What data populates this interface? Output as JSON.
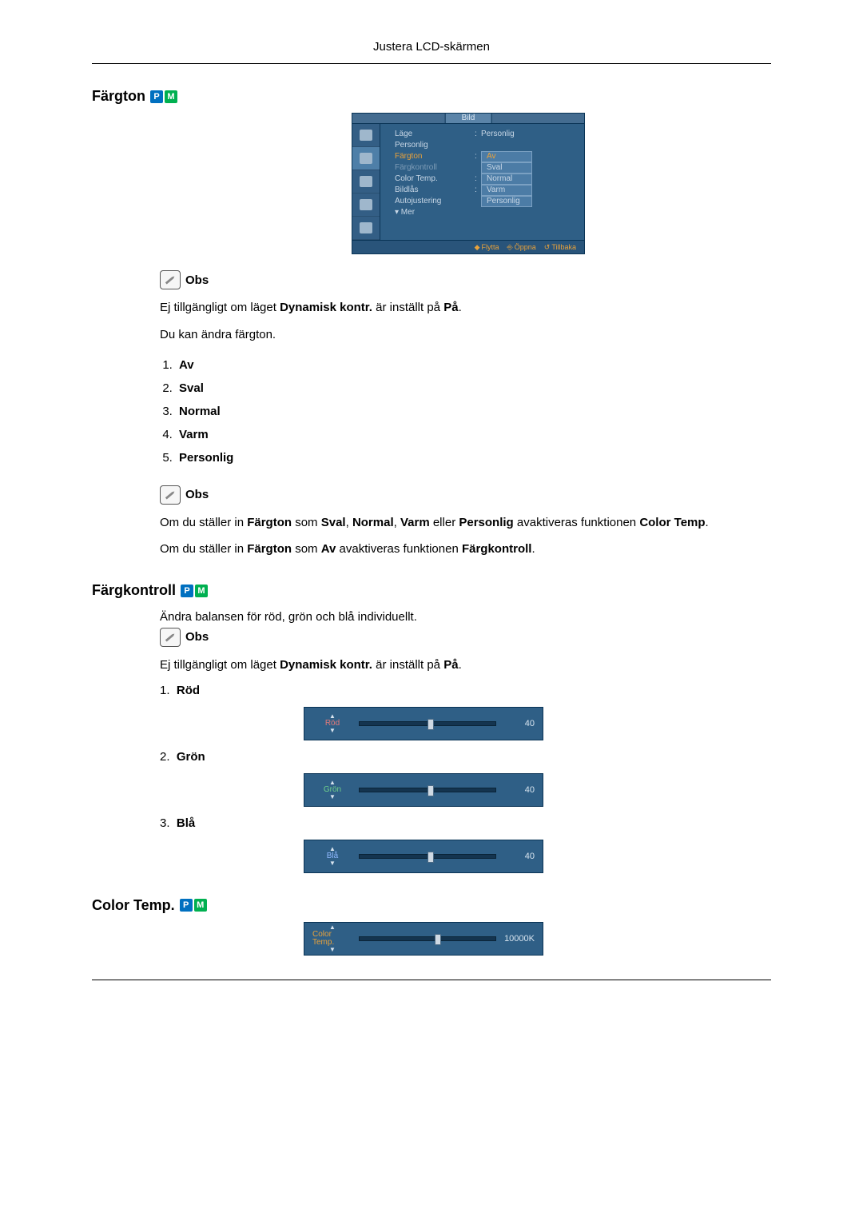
{
  "header": "Justera LCD-skärmen",
  "badges": {
    "p": "P",
    "m": "M"
  },
  "sections": {
    "fargton": {
      "title": "Färgton",
      "osd": {
        "tab": "Bild",
        "rows": {
          "lage": {
            "label": "Läge",
            "value": "Personlig"
          },
          "personlig": {
            "label": "Personlig"
          },
          "fargton": {
            "label": "Färgton",
            "value": "Av"
          },
          "fargkontroll": {
            "label": "Färgkontroll",
            "value": "Sval"
          },
          "colortemp": {
            "label": "Color Temp.",
            "value": "Normal"
          },
          "bildlas": {
            "label": "Bildlås",
            "value": "Varm"
          },
          "autoj": {
            "label": "Autojustering",
            "value": "Personlig"
          },
          "mer": {
            "label": "▾ Mer"
          }
        },
        "footer": {
          "move": "Flytta",
          "open": "Öppna",
          "back": "Tillbaka"
        }
      },
      "note1_label": "Obs",
      "note1_text_a": "Ej tillgängligt om läget ",
      "note1_text_b": "Dynamisk kontr.",
      "note1_text_c": " är inställt på ",
      "note1_text_d": "På",
      "p_changeable": "Du kan ändra färgton.",
      "list": [
        "Av",
        "Sval",
        "Normal",
        "Varm",
        "Personlig"
      ],
      "note2_label": "Obs",
      "p_sval_a": "Om du ställer in ",
      "p_sval_b": "Färgton",
      "p_sval_c": " som ",
      "p_sval_d": "Sval",
      "p_sval_e": ", ",
      "p_sval_f": "Normal",
      "p_sval_g": ", ",
      "p_sval_h": "Varm",
      "p_sval_i": " eller ",
      "p_sval_j": "Personlig",
      "p_sval_k": " avaktiveras funktionen ",
      "p_sval_l": "Color Temp",
      "p_sval_m": ".",
      "p_av_a": "Om du ställer in ",
      "p_av_b": "Färgton",
      "p_av_c": " som ",
      "p_av_d": "Av",
      "p_av_e": " avaktiveras funktionen ",
      "p_av_f": "Färgkontroll",
      "p_av_g": "."
    },
    "fargkontroll": {
      "title": "Färgkontroll",
      "intro": "Ändra balansen för röd, grön och blå individuellt.",
      "note_label": "Obs",
      "note_a": "Ej tillgängligt om läget ",
      "note_b": "Dynamisk kontr.",
      "note_c": " är inställt på ",
      "note_d": "På",
      "rows": {
        "rod": {
          "num": "1.",
          "label": "Röd",
          "name": "Röd",
          "value": "40",
          "pos": 50
        },
        "gron": {
          "num": "2.",
          "label": "Grön",
          "name": "Grön",
          "value": "40",
          "pos": 50
        },
        "bla": {
          "num": "3.",
          "label": "Blå",
          "name": "Blå",
          "value": "40",
          "pos": 50
        }
      }
    },
    "colortemp": {
      "title": "Color Temp.",
      "slider": {
        "name": "Color Temp.",
        "value": "10000K",
        "pos": 55
      }
    }
  }
}
